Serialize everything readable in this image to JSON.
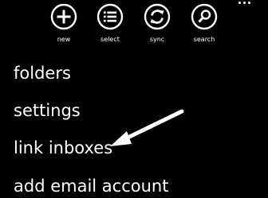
{
  "app_bar": {
    "buttons": [
      {
        "label": "new",
        "icon": "plus-icon"
      },
      {
        "label": "select",
        "icon": "list-icon"
      },
      {
        "label": "sync",
        "icon": "sync-icon"
      },
      {
        "label": "search",
        "icon": "search-icon"
      }
    ],
    "more_icon": "ellipsis-icon"
  },
  "menu": {
    "items": [
      {
        "label": "folders"
      },
      {
        "label": "settings"
      },
      {
        "label": "link inboxes"
      },
      {
        "label": "add email account"
      }
    ]
  },
  "annotation": {
    "arrow_icon": "arrow-icon",
    "points_to": "link inboxes"
  },
  "colors": {
    "background": "#000000",
    "foreground": "#ffffff"
  }
}
